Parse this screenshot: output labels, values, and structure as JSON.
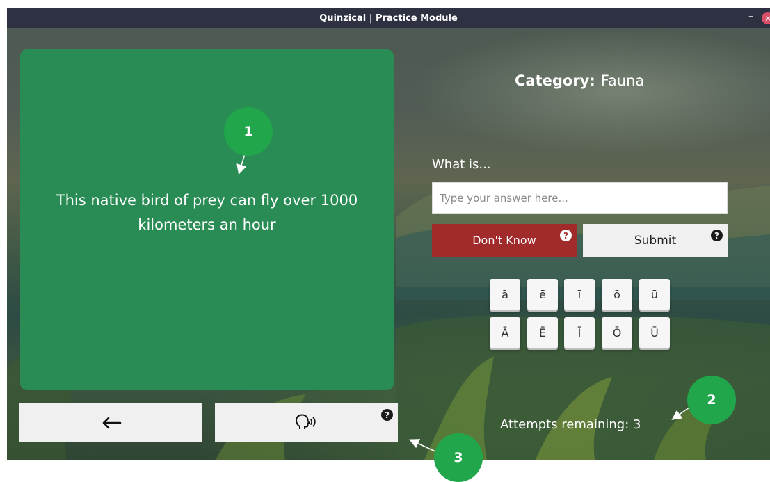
{
  "window": {
    "title": "Quinzical | Practice Module",
    "minimize": "–",
    "close": "×"
  },
  "question": {
    "text": "This native bird of prey can fly over 1000 kilometers an hour"
  },
  "category": {
    "label": "Category:",
    "value": "Fauna"
  },
  "answer": {
    "prompt": "What is...",
    "placeholder": "Type your answer here...",
    "value": ""
  },
  "buttons": {
    "dont_know": "Don't Know",
    "submit": "Submit",
    "help": "?",
    "back_icon": "left-arrow-icon",
    "speak_icon": "speaking-head-icon"
  },
  "macrons": {
    "lower": [
      "ā",
      "ē",
      "ī",
      "ō",
      "ū"
    ],
    "upper": [
      "Ā",
      "Ē",
      "Ī",
      "Ō",
      "Ū"
    ]
  },
  "attempts": {
    "text": "Attempts remaining: 3"
  },
  "annotations": [
    "1",
    "2",
    "3"
  ],
  "colors": {
    "card_green": "#2a8c55",
    "dont_know_red": "#a12b2b",
    "badge_green": "#21a64c",
    "titlebar": "#2d3141"
  }
}
